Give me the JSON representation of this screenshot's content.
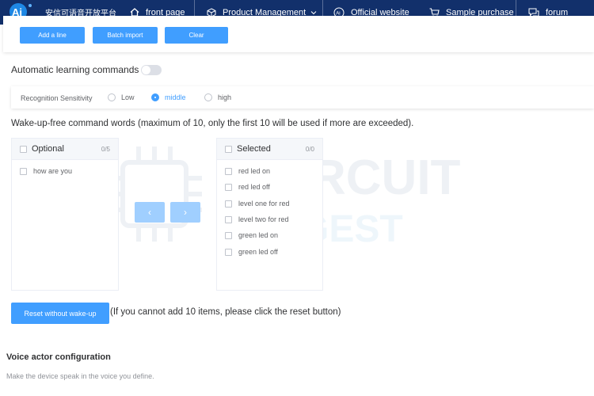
{
  "nav": {
    "brand": "安信可语音开放平台",
    "logo_text": "Ai",
    "items": [
      {
        "label": "front page",
        "icon": "home-icon"
      },
      {
        "label": "Product Management",
        "icon": "cube-icon"
      },
      {
        "label": "Official website",
        "icon": "ai-icon"
      },
      {
        "label": "Sample purchase",
        "icon": "cart-icon"
      },
      {
        "label": "forum",
        "icon": "forum-icon"
      }
    ],
    "bg_color": "#12306b"
  },
  "actions": {
    "add_line": "Add a line",
    "batch_import": "Batch import",
    "clear": "Clear"
  },
  "auto_learning": {
    "label": "Automatic learning commands",
    "enabled": false
  },
  "sensitivity": {
    "label": "Recognition Sensitivity",
    "options": [
      "Low",
      "middle",
      "high"
    ],
    "selected": "middle"
  },
  "wake_free": {
    "title": "Wake-up-free command words (maximum of 10, only the first 10 will be used if more are exceeded).",
    "optional": {
      "title": "Optional",
      "count": "0/5",
      "items": [
        "how are you"
      ]
    },
    "selected": {
      "title": "Selected",
      "count": "0/0",
      "items": [
        "red led on",
        "red led off",
        "level one for red",
        "level two for red",
        "green led on",
        "green led off"
      ]
    },
    "arrow_left": "‹",
    "arrow_right": "›"
  },
  "reset": {
    "button": "Reset without wake-up",
    "note": "(If you cannot add 10 items, please click the reset button)"
  },
  "voice": {
    "title": "Voice actor configuration",
    "desc": "Make the device speak in the voice you define."
  },
  "watermark": {
    "line1": "CIRCUIT",
    "line2": "DIGEST"
  },
  "colors": {
    "primary": "#409eff",
    "primary_disabled": "#a0cfff"
  }
}
